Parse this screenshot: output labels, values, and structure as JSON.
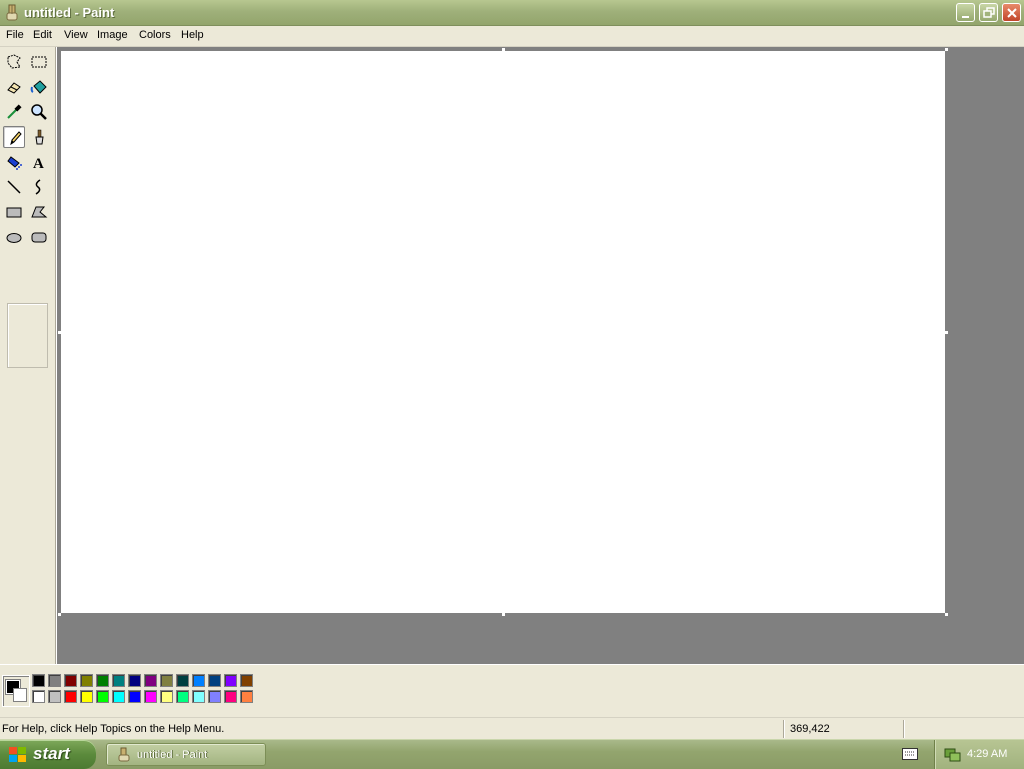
{
  "window": {
    "title": "untitled - Paint",
    "controls": [
      "minimize-button",
      "restore-button",
      "close-button"
    ]
  },
  "menubar": {
    "items": [
      "File",
      "Edit",
      "View",
      "Image",
      "Colors",
      "Help"
    ]
  },
  "toolbox": {
    "tools": [
      "free-form-select",
      "select",
      "eraser",
      "fill-with-color",
      "pick-color",
      "magnifier",
      "pencil",
      "brush",
      "airbrush",
      "text",
      "line",
      "curve",
      "rectangle",
      "polygon",
      "ellipse",
      "rounded-rectangle"
    ],
    "selected": "pencil"
  },
  "palette": {
    "foreground": "#000000",
    "background": "#ffffff",
    "top_row": [
      "#000000",
      "#808080",
      "#800000",
      "#808000",
      "#008000",
      "#008080",
      "#000080",
      "#800080",
      "#808040",
      "#004040",
      "#0080ff",
      "#004080",
      "#8000ff",
      "#804000"
    ],
    "bottom_row": [
      "#ffffff",
      "#c0c0c0",
      "#ff0000",
      "#ffff00",
      "#00ff00",
      "#00ffff",
      "#0000ff",
      "#ff00ff",
      "#ffff80",
      "#00ff80",
      "#80ffff",
      "#8080ff",
      "#ff0080",
      "#ff8040"
    ]
  },
  "statusbar": {
    "help_text": "For Help, click Help Topics on the Help Menu.",
    "coordinates": "369,422"
  },
  "taskbar": {
    "start_label": "start",
    "task_label": "untitled - Paint",
    "clock": "4:29 AM"
  }
}
